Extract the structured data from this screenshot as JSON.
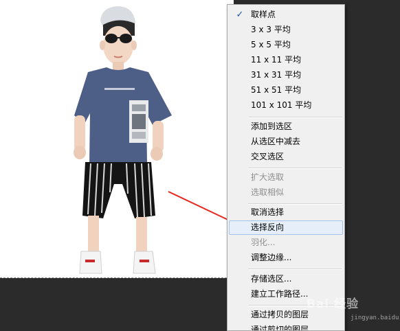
{
  "context_menu": {
    "items": [
      {
        "label": "取样点",
        "checked": true,
        "enabled": true
      },
      {
        "label": "3 x 3 平均",
        "enabled": true
      },
      {
        "label": "5 x 5 平均",
        "enabled": true
      },
      {
        "label": "11 x 11 平均",
        "enabled": true
      },
      {
        "label": "31 x 31 平均",
        "enabled": true
      },
      {
        "label": "51 x 51 平均",
        "enabled": true
      },
      {
        "label": "101 x 101 平均",
        "enabled": true
      },
      {
        "label": "添加到选区",
        "enabled": true
      },
      {
        "label": "从选区中减去",
        "enabled": true
      },
      {
        "label": "交叉选区",
        "enabled": true
      },
      {
        "label": "扩大选取",
        "enabled": false
      },
      {
        "label": "选取相似",
        "enabled": false
      },
      {
        "label": "取消选择",
        "enabled": true
      },
      {
        "label": "选择反向",
        "enabled": true,
        "highlighted": true
      },
      {
        "label": "羽化...",
        "enabled": false
      },
      {
        "label": "调整边缘...",
        "enabled": true
      },
      {
        "label": "存储选区...",
        "enabled": true
      },
      {
        "label": "建立工作路径...",
        "enabled": true
      },
      {
        "label": "通过拷贝的图层",
        "enabled": true
      },
      {
        "label": "通过剪切的图层",
        "enabled": true
      }
    ]
  },
  "watermark": {
    "brand": "Bai 经验",
    "url": "jingyan.baidu.com"
  },
  "colors": {
    "arrow": "#e8271e",
    "menu_bg": "#f0f0f0",
    "highlight": "#e5eef9",
    "checkmark": "#1c4fa0"
  },
  "icons": [
    "checkmark-icon",
    "red-arrow-annotation"
  ]
}
